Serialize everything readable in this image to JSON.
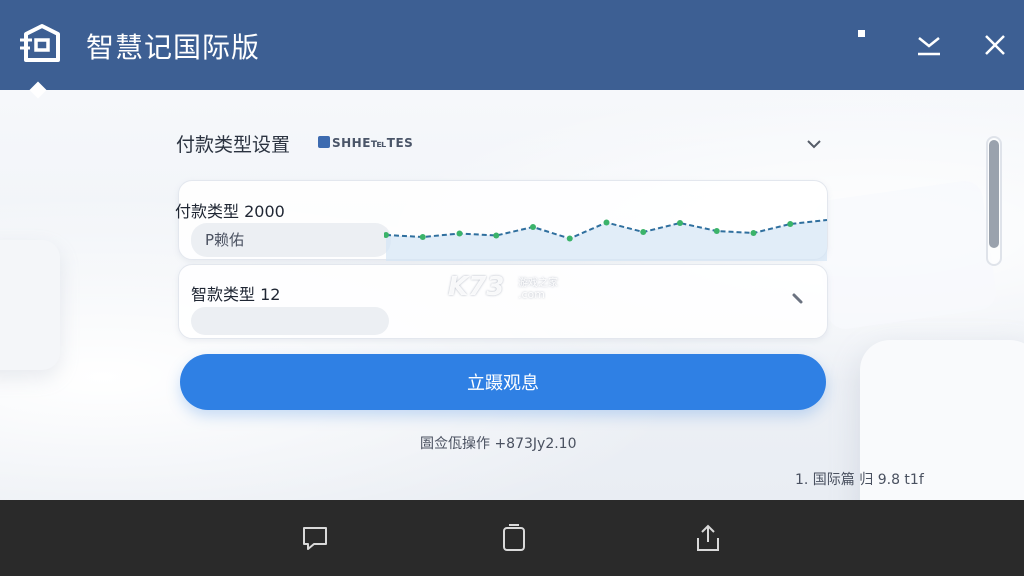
{
  "app": {
    "title": "智慧记国际版",
    "title_bar_color": "#3d5f93",
    "accent_color": "#2f80e4"
  },
  "titlebar": {
    "logo_icon": "app-logo-icon",
    "minimize_icon": "minimize-icon",
    "close_icon": "close-icon"
  },
  "section": {
    "title": "付款类型设置",
    "badge": "SHHE℡TES",
    "collapse_icon": "chevron-down-icon"
  },
  "cards": [
    {
      "label": "付款类型 2000",
      "pill": "P赖佑"
    },
    {
      "label": "智款类型 12",
      "pill": "",
      "edit_icon": "pencil-icon"
    }
  ],
  "chart_data": {
    "type": "line",
    "values": [
      40,
      36,
      43,
      39,
      56,
      33,
      65,
      46,
      64,
      48,
      44,
      62,
      70
    ],
    "ylim": [
      0,
      100
    ],
    "color": "#2f6f9e",
    "fill_color": "#d4e6f5"
  },
  "primary_button": {
    "label": "立蹑观息"
  },
  "status": {
    "text": "圄佥佤操作 +873Jy2.10"
  },
  "version": {
    "text": "1. 国际篇 归 9.8 t1f"
  },
  "watermark": {
    "main": "K73",
    "sub": "游戏之家",
    "domain": ".com"
  },
  "navbar": {
    "back_icon": "back-icon",
    "home_icon": "home-icon",
    "share_icon": "share-icon",
    "bg_color": "#2a2a2a"
  }
}
